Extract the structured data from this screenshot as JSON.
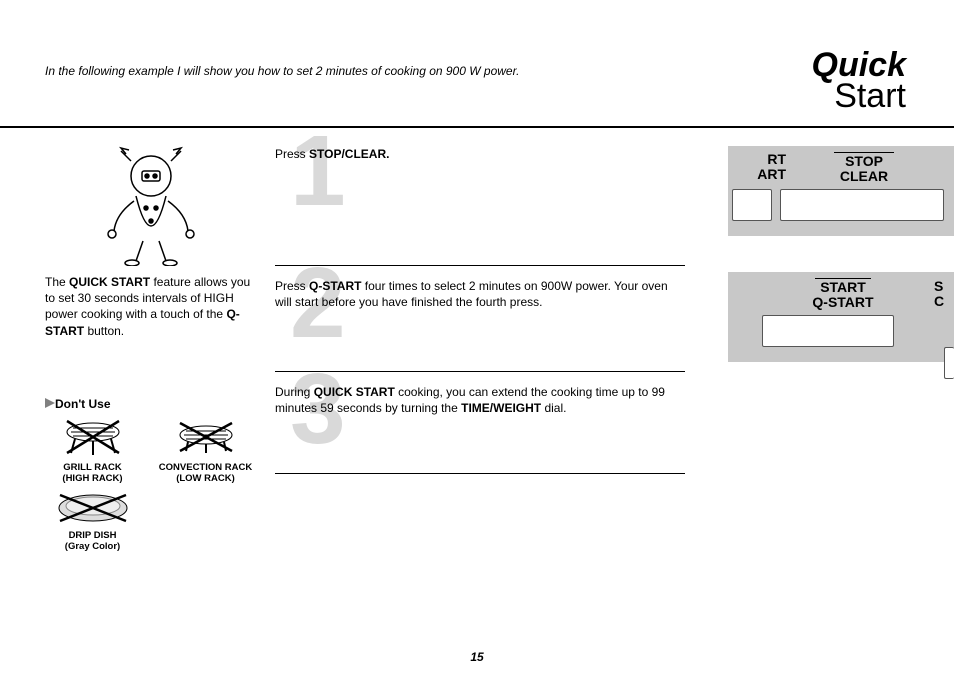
{
  "header": {
    "intro": "In the following example I will show you how to set 2 minutes of cooking on 900 W power.",
    "title_bold": "Quick",
    "title_light": "Start"
  },
  "left": {
    "desc_prefix": "The ",
    "desc_b1": "QUICK START",
    "desc_mid": " feature allows you to set 30 seconds intervals of HIGH power cooking with a touch of the ",
    "desc_b2": "Q- START",
    "desc_suffix": " button.",
    "dont_use": "Don't Use",
    "items": {
      "grill": {
        "l1": "GRILL RACK",
        "l2": "(HIGH RACK)"
      },
      "conv": {
        "l1": "CONVECTION RACK",
        "l2": "(LOW RACK)"
      },
      "drip": {
        "l1": "DRIP DISH",
        "l2": "(Gray Color)"
      }
    }
  },
  "steps": {
    "s1": {
      "num": "1",
      "pre": "Press ",
      "b": "STOP/CLEAR."
    },
    "s2": {
      "num": "2",
      "pre": "Press ",
      "b": "Q-START",
      "post": " four times to select 2 minutes on 900W power. Your oven will start before you have finished the fourth press."
    },
    "s3": {
      "num": "3",
      "pre": "During ",
      "b1": "QUICK START",
      "mid": " cooking, you can extend the cooking time up to 99 minutes 59 seconds by turning the ",
      "b2": "TIME/WEIGHT",
      "post": " dial."
    }
  },
  "panels": {
    "p1": {
      "col1a": "RT",
      "col1b": "ART",
      "col2a": "STOP",
      "col2b": "CLEAR"
    },
    "p2": {
      "col1a": "START",
      "col1b": "Q-START",
      "col2a": "S",
      "col2b": "C"
    }
  },
  "page_number": "15"
}
